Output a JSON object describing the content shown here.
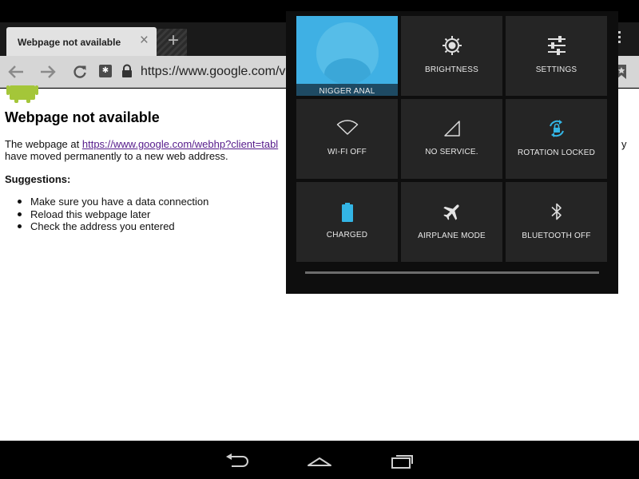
{
  "browser": {
    "tab": {
      "title": "Webpage not available",
      "close_glyph": "×"
    },
    "new_tab_glyph": "+",
    "toolbar": {
      "back_icon": "back-arrow-icon",
      "forward_icon": "forward-arrow-icon",
      "reload_icon": "reload-icon",
      "url": "https://www.google.com/v",
      "accent": "#555555"
    }
  },
  "page": {
    "title": "Webpage not available",
    "message_prefix": "The webpage at ",
    "message_link": "https://www.google.com/webhp?client=tabl",
    "message_continued": "y",
    "message_line2": "have moved permanently to a new web address.",
    "suggestions_heading": "Suggestions:",
    "suggestions": [
      "Make sure you have a data connection",
      "Reload this webpage later",
      "Check the address you entered"
    ]
  },
  "quick_settings": {
    "accent": "#33b5e5",
    "tiles": [
      {
        "label": "NIGGER ANAL",
        "icon": "user-avatar-icon"
      },
      {
        "label": "BRIGHTNESS",
        "icon": "brightness-icon"
      },
      {
        "label": "SETTINGS",
        "icon": "settings-sliders-icon"
      },
      {
        "label": "WI-FI OFF",
        "icon": "wifi-icon"
      },
      {
        "label": "NO SERVICE.",
        "icon": "signal-icon"
      },
      {
        "label": "ROTATION LOCKED",
        "icon": "rotation-lock-icon"
      },
      {
        "label": "CHARGED",
        "icon": "battery-icon"
      },
      {
        "label": "AIRPLANE MODE",
        "icon": "airplane-icon"
      },
      {
        "label": "BLUETOOTH OFF",
        "icon": "bluetooth-icon"
      }
    ]
  },
  "nav": {
    "back_icon": "nav-back-icon",
    "home_icon": "nav-home-icon",
    "recents_icon": "nav-recents-icon"
  }
}
